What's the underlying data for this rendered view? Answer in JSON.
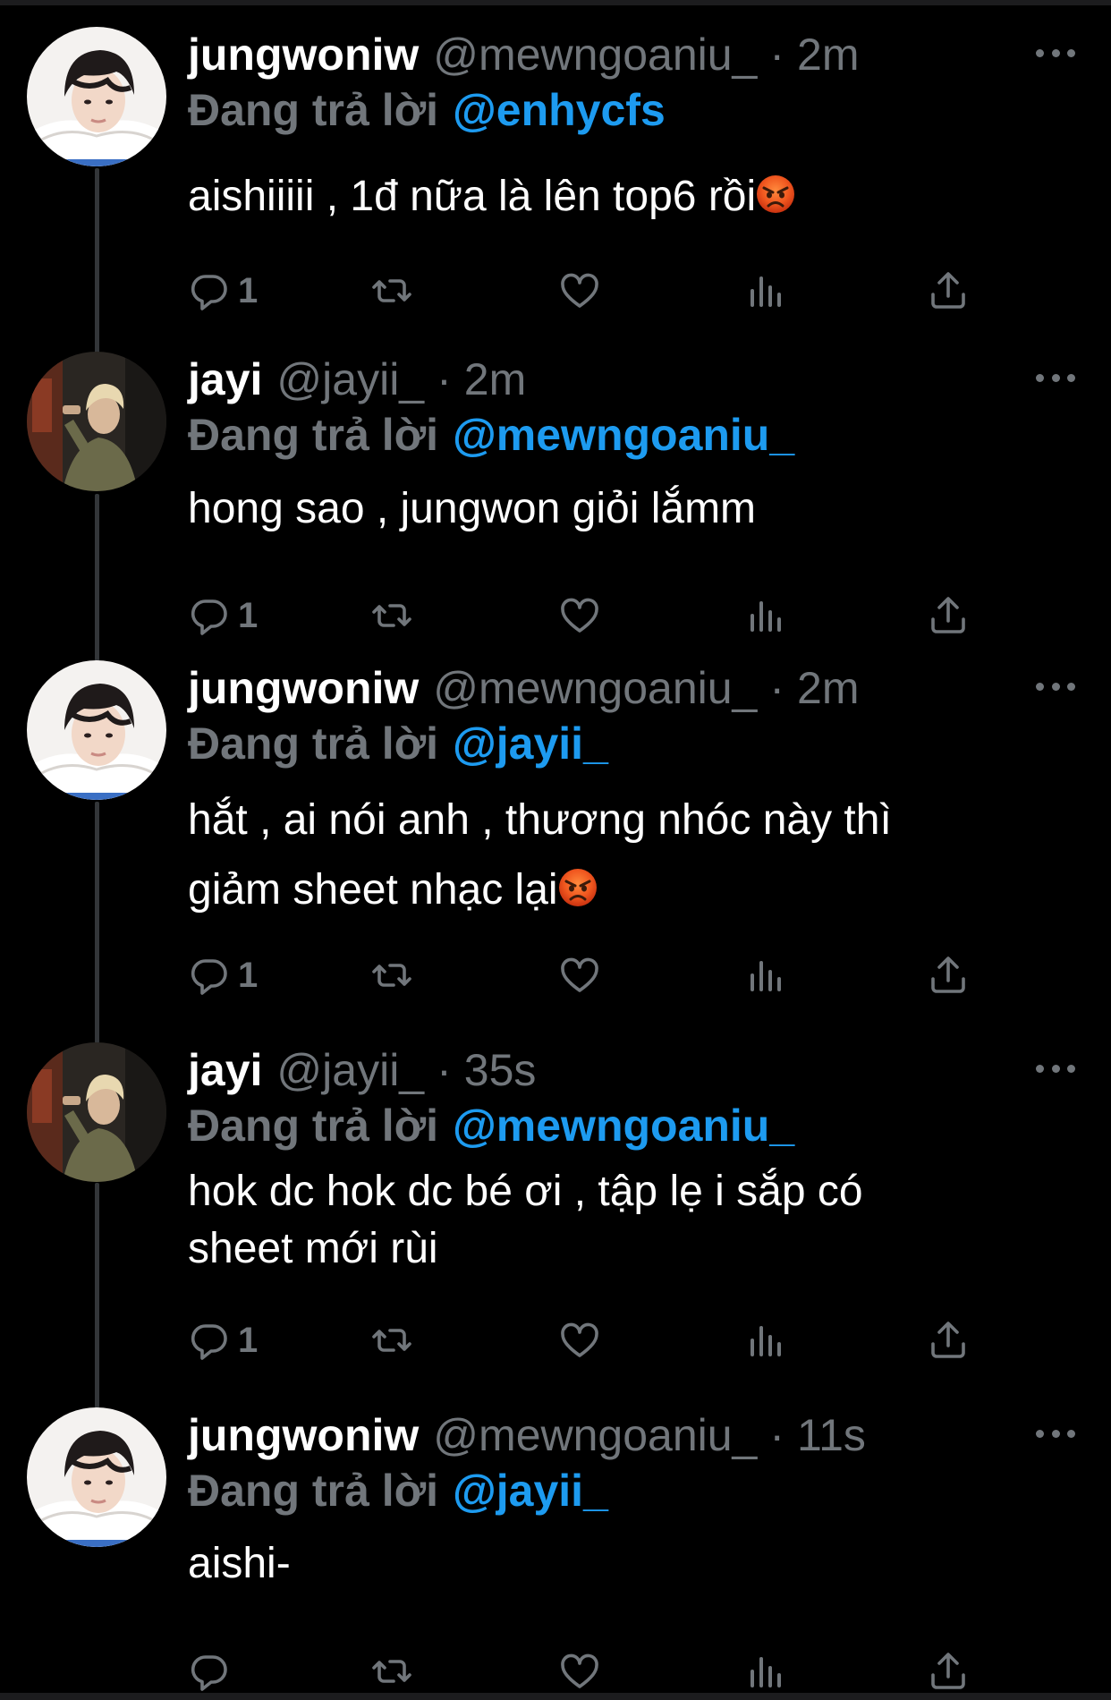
{
  "colors": {
    "background": "#000000",
    "muted": "#71767b",
    "accent": "#1d9bf0",
    "text": "#ffffff"
  },
  "tweets": [
    {
      "avatar": "avatar-jungwoniw",
      "display_name": "jungwoniw",
      "handle": "@mewngoaniu_",
      "dot": "·",
      "time": "2m",
      "reply_prefix": "Đang trả lời",
      "reply_to": "@enhycfs",
      "text": "aishiiiii , 1đ nữa là lên top6 rồi",
      "emoji": "angry-face-emoji",
      "reply_count": "1"
    },
    {
      "avatar": "avatar-jayi",
      "display_name": "jayi",
      "handle": "@jayii_",
      "dot": "·",
      "time": "2m",
      "reply_prefix": "Đang trả lời",
      "reply_to": "@mewngoaniu_",
      "text": "hong sao , jungwon giỏi lắmm",
      "reply_count": "1"
    },
    {
      "avatar": "avatar-jungwoniw",
      "display_name": "jungwoniw",
      "handle": "@mewngoaniu_",
      "dot": "·",
      "time": "2m",
      "reply_prefix": "Đang trả lời",
      "reply_to": "@jayii_",
      "text_line1": "hắt , ai nói anh , thương nhóc này thì",
      "text_line2": "giảm sheet nhạc lại",
      "emoji": "angry-face-emoji",
      "reply_count": "1"
    },
    {
      "avatar": "avatar-jayi",
      "display_name": "jayi",
      "handle": "@jayii_",
      "dot": "·",
      "time": "35s",
      "reply_prefix": "Đang trả lời",
      "reply_to": "@mewngoaniu_",
      "text_line1": "hok dc hok dc bé ơi , tập lẹ i sắp có",
      "text_line2": "sheet mới rùi",
      "reply_count": "1"
    },
    {
      "avatar": "avatar-jungwoniw",
      "display_name": "jungwoniw",
      "handle": "@mewngoaniu_",
      "dot": "·",
      "time": "11s",
      "reply_prefix": "Đang trả lời",
      "reply_to": "@jayii_",
      "text": "aishi-",
      "reply_count": ""
    }
  ],
  "action_icons": [
    "reply-icon",
    "retweet-icon",
    "like-icon",
    "views-icon",
    "share-icon"
  ]
}
